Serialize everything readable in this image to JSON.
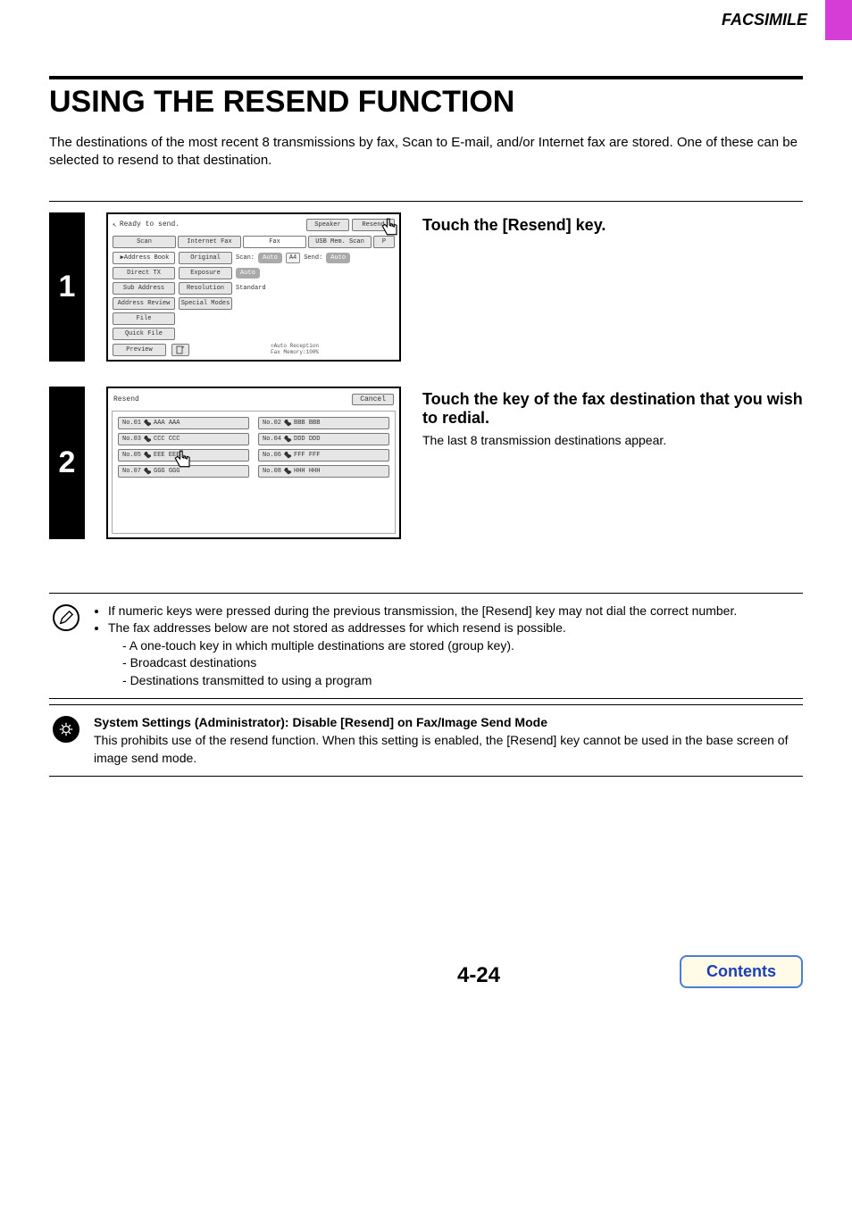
{
  "header": {
    "section": "FACSIMILE"
  },
  "title": "USING THE RESEND FUNCTION",
  "intro": "The destinations of the most recent 8 transmissions by fax, Scan to E-mail, and/or Internet fax are stored. One of these can be selected to resend to that destination.",
  "step1": {
    "num": "1",
    "instruction": "Touch the [Resend] key.",
    "panel": {
      "ready": "Ready to send.",
      "speaker": "Speaker",
      "resend": "Resend",
      "tabs": {
        "scan": "Scan",
        "ifax": "Internet Fax",
        "fax": "Fax",
        "usb": "USB Mem. Scan",
        "pc": "P"
      },
      "side": {
        "addressbook": "Address Book",
        "directtx": "Direct TX",
        "subaddress": "Sub Address",
        "addressreview": "Address Review",
        "file": "File",
        "quickfile": "Quick File",
        "preview": "Preview"
      },
      "right": {
        "original": "Original",
        "scan_lbl": "Scan:",
        "auto": "Auto",
        "a4": "A4",
        "send_lbl": "Send:",
        "send_auto": "Auto",
        "exposure": "Exposure",
        "exposure_val": "Auto",
        "resolution": "Resolution",
        "resolution_val": "Standard",
        "special": "Special Modes"
      },
      "bottom": {
        "auto_recv": "Auto Reception",
        "memory": "Fax Memory:100%"
      }
    }
  },
  "step2": {
    "num": "2",
    "instruction": "Touch the key of the fax destination that you wish to redial.",
    "body": "The last 8 transmission destinations appear.",
    "panel": {
      "title": "Resend",
      "cancel": "Cancel",
      "items": [
        {
          "no": "No.01",
          "name": "AAA AAA"
        },
        {
          "no": "No.02",
          "name": "BBB BBB"
        },
        {
          "no": "No.03",
          "name": "CCC CCC"
        },
        {
          "no": "No.04",
          "name": "DDD DDD"
        },
        {
          "no": "No.05",
          "name": "EEE EEE"
        },
        {
          "no": "No.06",
          "name": "FFF FFF"
        },
        {
          "no": "No.07",
          "name": "GGG GGG"
        },
        {
          "no": "No.08",
          "name": "HHH HHH"
        }
      ]
    }
  },
  "note1": {
    "b1": "If numeric keys were pressed during the previous transmission, the [Resend] key may not dial the correct number.",
    "b2": "The fax addresses below are not stored as addresses for which resend is possible.",
    "s1": "A one-touch key in which multiple destinations are stored (group key).",
    "s2": "Broadcast destinations",
    "s3": "Destinations transmitted to using a program"
  },
  "note2": {
    "title": "System Settings (Administrator): Disable [Resend] on Fax/Image Send Mode",
    "body": "This prohibits use of the resend function. When this setting is enabled, the [Resend] key cannot be used in the base screen of image send mode."
  },
  "footer": {
    "page": "4-24",
    "contents": "Contents"
  }
}
